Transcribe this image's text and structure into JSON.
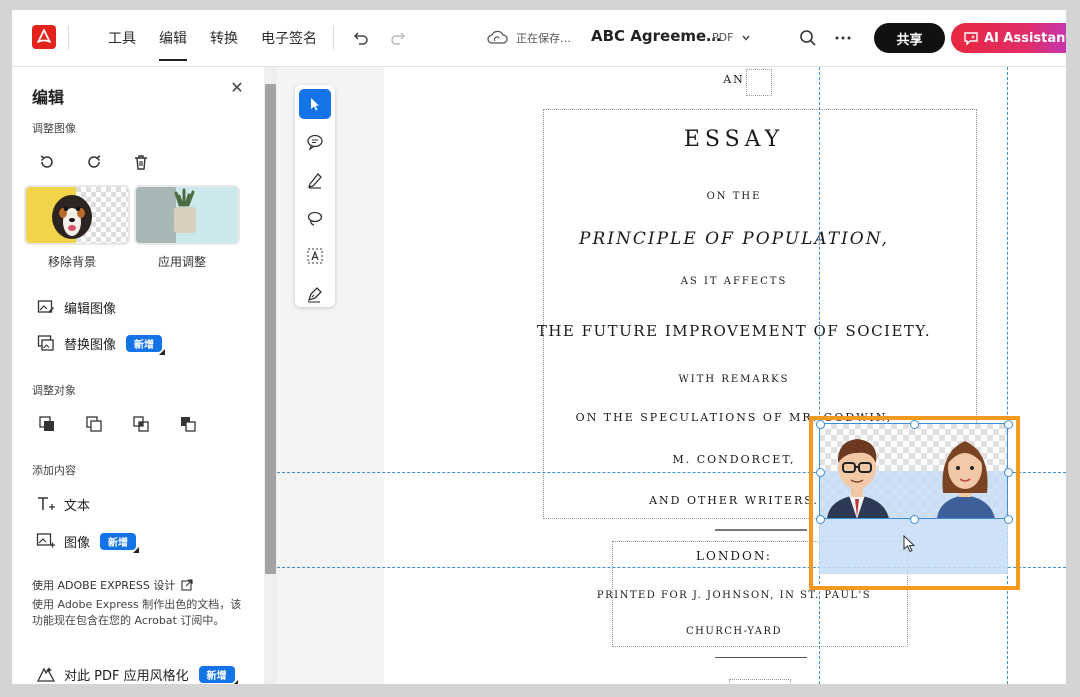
{
  "topbar": {
    "nav": [
      "工具",
      "编辑",
      "转换",
      "电子签名"
    ],
    "active_nav": "编辑",
    "saving_status": "正在保存…",
    "document_name": "ABC Agreeme…",
    "document_type": "PDF",
    "share_label": "共享",
    "ai_label": "AI Assistant",
    "brand_color": "#e2231a",
    "ai_gradient": [
      "#e8283e",
      "#b43bd8"
    ]
  },
  "panel": {
    "title": "编辑",
    "section_adjust_image": "调整图像",
    "remove_bg_label": "移除背景",
    "apply_adjust_label": "应用调整",
    "edit_image_label": "编辑图像",
    "replace_image_label": "替换图像",
    "new_badge": "新增",
    "section_adjust_object": "调整对象",
    "section_add_content": "添加内容",
    "text_label": "文本",
    "image_label": "图像",
    "express_heading": "使用 ADOBE EXPRESS 设计",
    "express_desc": "使用 Adobe Express 制作出色的文档，该功能现在包含在您的 Acrobat 订阅中。",
    "style_pdf_label": "对此 PDF 应用风格化"
  },
  "document": {
    "line_an": "AN",
    "title": "ESSAY",
    "on_the": "ON THE",
    "principle": "PRINCIPLE OF POPULATION,",
    "as_it_affects": "AS IT AFFECTS",
    "future": "THE FUTURE IMPROVEMENT OF SOCIETY.",
    "with_remarks": "WITH REMARKS",
    "speculations": "ON THE SPECULATIONS OF MR. GODWIN,",
    "condorcet": "M. CONDORCET,",
    "other_writers": "AND OTHER WRITERS.",
    "london": "LONDON:",
    "printed_for": "PRINTED FOR J. JOHNSON, IN ST. PAUL'S",
    "churchyard": "CHURCH-YARD"
  },
  "colors": {
    "accent": "#1473e6",
    "selection": "#f39a1f",
    "guide": "#3a8fd8"
  },
  "icons": [
    "acrobat-logo-icon",
    "undo-icon",
    "redo-icon",
    "cloud-sync-icon",
    "chevron-down-icon",
    "search-icon",
    "more-icon",
    "chat-ai-icon",
    "close-icon",
    "rotate-left-icon",
    "rotate-right-icon",
    "trash-icon",
    "edit-image-icon",
    "replace-image-icon",
    "text-icon",
    "image-icon",
    "external-link-icon",
    "style-icon",
    "select-arrow-icon",
    "comment-icon",
    "highlight-pen-icon",
    "lasso-icon",
    "text-box-icon",
    "signature-pen-icon"
  ]
}
